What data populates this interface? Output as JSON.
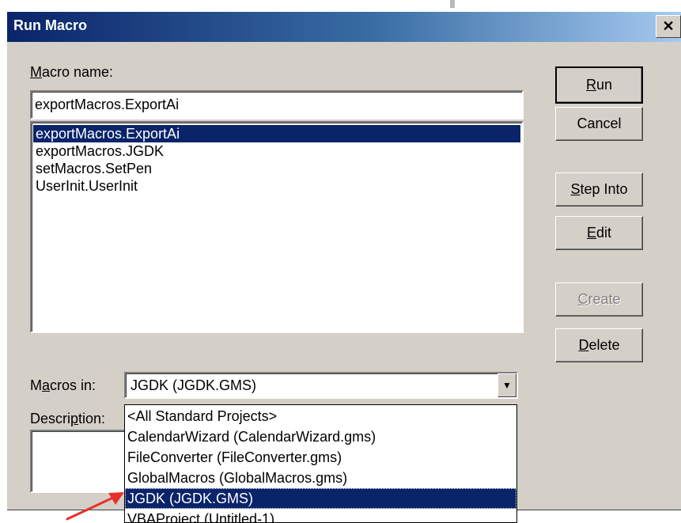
{
  "window": {
    "title": "Run Macro",
    "close_glyph": "✕"
  },
  "macro_name": {
    "label_accel": "M",
    "label_rest": "acro name:",
    "value": "exportMacros.ExportAi",
    "items": [
      "exportMacros.ExportAi",
      "exportMacros.JGDK",
      "setMacros.SetPen",
      "UserInit.UserInit"
    ],
    "selected_index": 0
  },
  "macros_in": {
    "label_pre": "M",
    "label_accel": "a",
    "label_post": "cros in:",
    "value": "JGDK (JGDK.GMS)",
    "arrow_glyph": "▼"
  },
  "description": {
    "label_pre": "Descri",
    "label_accel": "p",
    "label_post": "tion:"
  },
  "buttons": {
    "run": {
      "accel": "R",
      "rest": "un"
    },
    "cancel": "Cancel",
    "step_into": {
      "accel": "S",
      "rest": "tep Into"
    },
    "edit": {
      "accel": "E",
      "rest": "dit"
    },
    "create": {
      "accel": "C",
      "rest": "reate"
    },
    "delete": {
      "accel": "D",
      "rest": "elete"
    }
  },
  "dropdown": {
    "options": [
      "<All Standard Projects>",
      "CalendarWizard (CalendarWizard.gms)",
      "FileConverter (FileConverter.gms)",
      "GlobalMacros (GlobalMacros.gms)",
      "JGDK (JGDK.GMS)",
      "VBAProject (Untitled-1)"
    ],
    "selected_index": 4
  },
  "colors": {
    "selection": "#0a246a",
    "dialog_face": "#d4d0c8",
    "annotation_arrow": "#e8302a"
  },
  "icons": {
    "annotation": "red-arrow-icon",
    "close": "close-icon",
    "combo": "chevron-down-icon"
  }
}
